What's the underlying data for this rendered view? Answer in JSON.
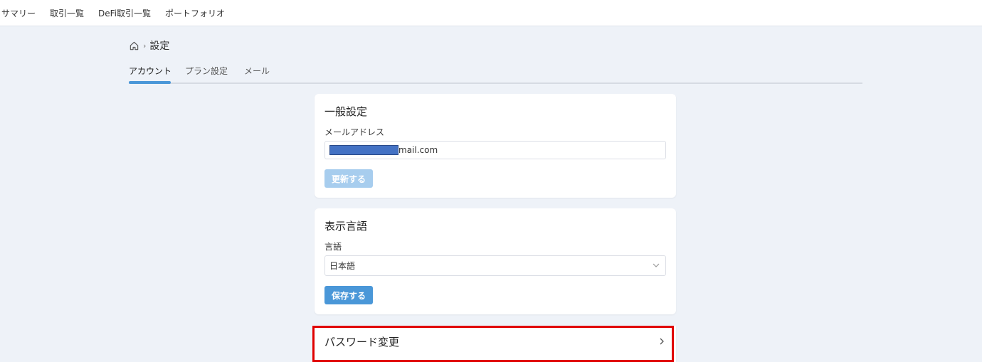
{
  "topnav": {
    "items": [
      "サマリー",
      "取引一覧",
      "DeFi取引一覧",
      "ポートフォリオ"
    ]
  },
  "breadcrumb": {
    "separator": "›",
    "title": "設定"
  },
  "tabs": [
    "アカウント",
    "プラン設定",
    "メール"
  ],
  "general": {
    "heading": "一般設定",
    "email_label": "メールアドレス",
    "email_value_visible": "mail.com",
    "update_button": "更新する"
  },
  "language": {
    "heading": "表示言語",
    "field_label": "言語",
    "selected": "日本語",
    "save_button": "保存する"
  },
  "password": {
    "label": "パスワード変更"
  },
  "colors": {
    "accent": "#4a97d8",
    "accent_disabled": "#a7cdee",
    "highlight": "#e00000",
    "redaction": "#4472c4"
  }
}
